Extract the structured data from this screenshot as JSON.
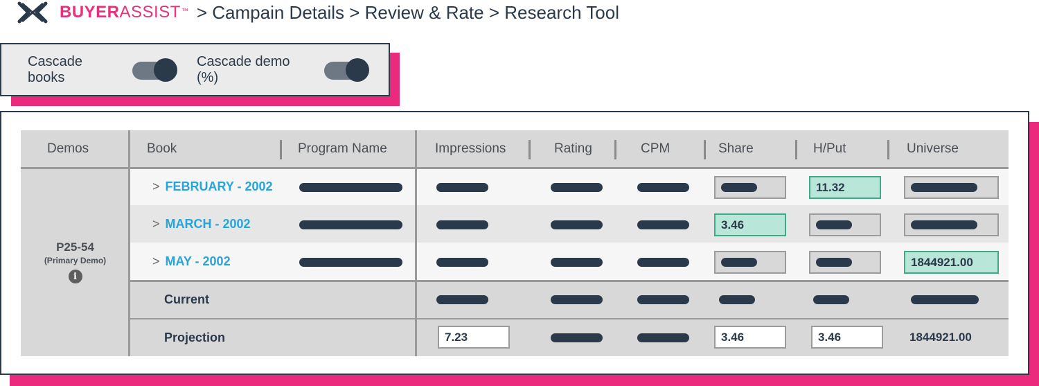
{
  "header": {
    "brand_bold": "BUYER",
    "brand_light": "ASSIST",
    "brand_tm": "™",
    "breadcrumb": "> Campain Details > Review & Rate > Research Tool"
  },
  "toggles": {
    "cascade_books": {
      "label": "Cascade books",
      "on": true
    },
    "cascade_demo": {
      "label": "Cascade demo (%)",
      "on": true
    }
  },
  "table": {
    "columns": [
      "Demos",
      "Book",
      "Program Name",
      "Impressions",
      "Rating",
      "CPM",
      "Share",
      "H/Put",
      "Universe"
    ],
    "demo": {
      "name": "P25-54",
      "sub": "(Primary Demo)",
      "info_icon": "i"
    },
    "rows": [
      {
        "book": "FEBRUARY - 2002",
        "hput": "11.32"
      },
      {
        "book": "MARCH - 2002",
        "share": "3.46"
      },
      {
        "book": "MAY - 2002",
        "universe": "1844921.00"
      }
    ],
    "current_label": "Current",
    "projection": {
      "label": "Projection",
      "impressions": "7.23",
      "share": "3.46",
      "hput": "3.46",
      "universe": "1844921.00"
    }
  },
  "colors": {
    "brand": "#e8307c",
    "accent_shadow": "#ec2a7d",
    "link": "#2aa4d6",
    "highlight": "#b8e6d8",
    "dark": "#2b3a4a"
  }
}
